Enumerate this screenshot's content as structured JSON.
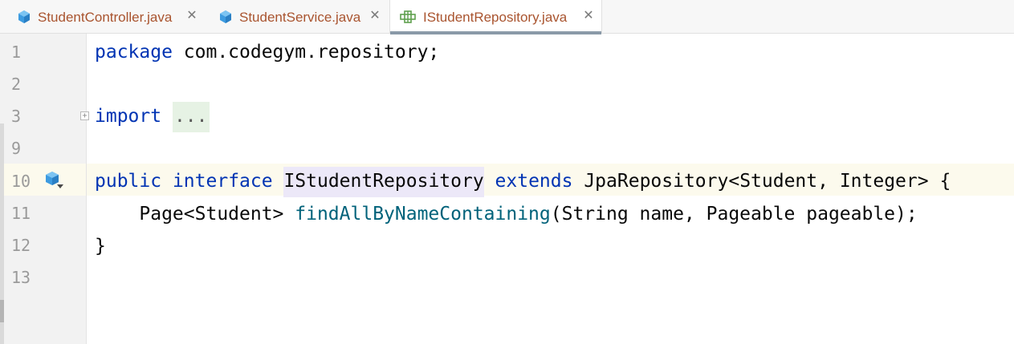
{
  "tabs": [
    {
      "label": "StudentController.java",
      "icon": "java-class-icon",
      "active": false
    },
    {
      "label": "StudentService.java",
      "icon": "java-class-icon",
      "active": false
    },
    {
      "label": "IStudentRepository.java",
      "icon": "interface-icon",
      "active": true
    }
  ],
  "tab_close_glyph": "✕",
  "gutter": {
    "line_numbers": [
      "1",
      "2",
      "3",
      "9",
      "10",
      "11",
      "12",
      "13"
    ],
    "fold_glyph": "+"
  },
  "code": {
    "line1": {
      "keyword": "package",
      "rest": " com.codegym.repository;"
    },
    "line3": {
      "keyword": "import",
      "space": " ",
      "folded": "..."
    },
    "line10": {
      "kw_public": "public",
      "kw_interface": "interface",
      "name": "IStudentRepository",
      "kw_extends": "extends",
      "rest": " JpaRepository<Student, Integer> {"
    },
    "line11": {
      "indent": "    ",
      "type": "Page<Student> ",
      "method": "findAllByNameContaining",
      "params": "(String name, Pageable pageable);"
    },
    "line12": {
      "text": "}"
    }
  },
  "colors": {
    "keyword": "#0033b3",
    "method": "#00627a",
    "tab_text": "#a9542f",
    "current_line": "#fcfaed"
  }
}
